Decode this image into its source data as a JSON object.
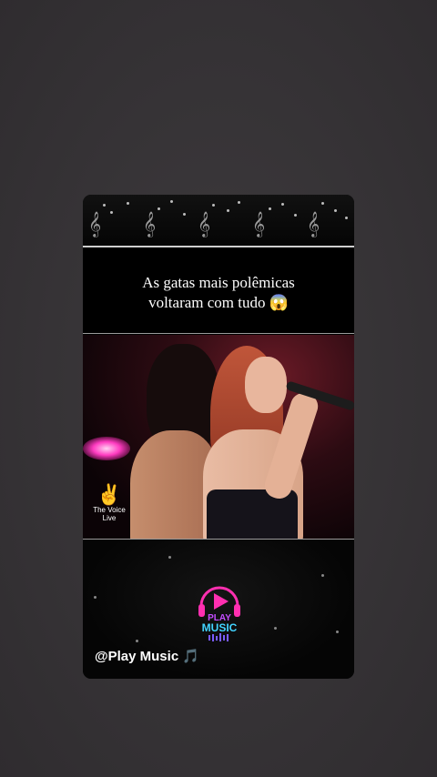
{
  "post": {
    "caption_line1": "As gatas mais polêmicas",
    "caption_line2": "voltaram com tudo 😱",
    "watermark": "@Play Music 🎵"
  },
  "video": {
    "show_logo_line1": "The Voice",
    "show_logo_line2": "Live"
  },
  "brand_logo": {
    "line1": "PLAY",
    "line2": "MUSIC"
  },
  "decor": {
    "music_note_glyph": "𝄞"
  }
}
